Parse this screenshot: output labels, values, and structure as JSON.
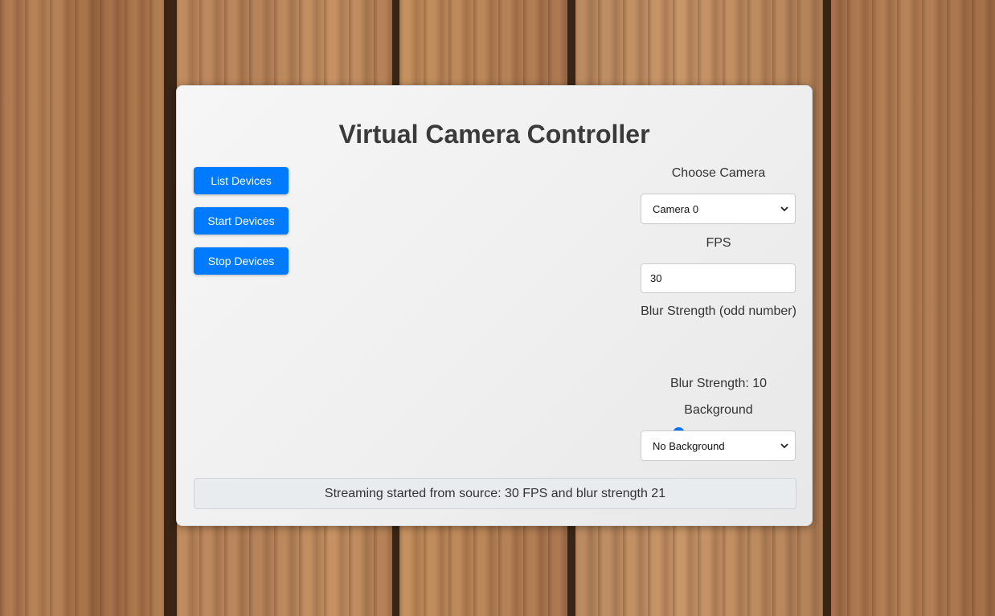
{
  "app": {
    "title": "Virtual Camera Controller"
  },
  "actions": {
    "list_label": "List Devices",
    "start_label": "Start Devices",
    "stop_label": "Stop Devices"
  },
  "controls": {
    "camera_label": "Choose Camera",
    "camera_selected": "Camera 0",
    "fps_label": "FPS",
    "fps_value": "30",
    "blur_label": "Blur Strength (odd number)",
    "blur_slider_fraction": 0.24,
    "blur_value_text": "Blur Strength: 10",
    "background_label": "Background",
    "background_selected": "No Background"
  },
  "status": {
    "message": "Streaming started from source: 30 FPS and blur strength 21"
  },
  "colors": {
    "accent": "#007bff",
    "slider": "#0075ff",
    "status_bg": "#e9ecef"
  },
  "icons": {
    "select_chevron": "chevron-down-icon"
  }
}
